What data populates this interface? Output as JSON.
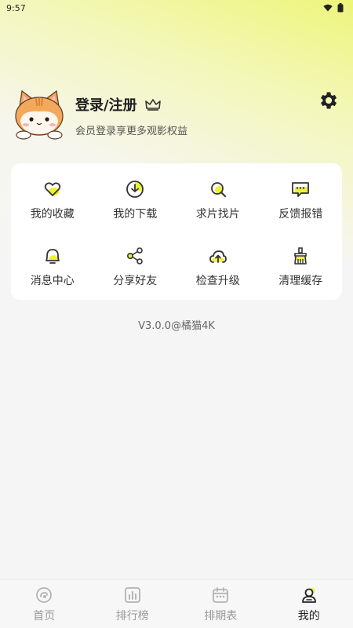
{
  "status_bar": {
    "time": "9:57"
  },
  "profile": {
    "title": "登录/注册",
    "subtitle": "会员登录享更多观影权益"
  },
  "grid": {
    "items": [
      {
        "label": "我的收藏",
        "icon": "heart-icon"
      },
      {
        "label": "我的下载",
        "icon": "download-icon"
      },
      {
        "label": "求片找片",
        "icon": "search-icon"
      },
      {
        "label": "反馈报错",
        "icon": "feedback-icon"
      },
      {
        "label": "消息中心",
        "icon": "bell-icon"
      },
      {
        "label": "分享好友",
        "icon": "share-icon"
      },
      {
        "label": "检查升级",
        "icon": "cloud-upload-icon"
      },
      {
        "label": "清理缓存",
        "icon": "broom-icon"
      }
    ]
  },
  "version": "V3.0.0@橘猫4K",
  "tabs": [
    {
      "label": "首页",
      "icon": "home-icon",
      "active": false
    },
    {
      "label": "排行榜",
      "icon": "chart-icon",
      "active": false
    },
    {
      "label": "排期表",
      "icon": "calendar-icon",
      "active": false
    },
    {
      "label": "我的",
      "icon": "user-icon",
      "active": true
    }
  ],
  "colors": {
    "accent": "#eef234",
    "text": "#222222",
    "inactive": "#9a9a9a"
  }
}
